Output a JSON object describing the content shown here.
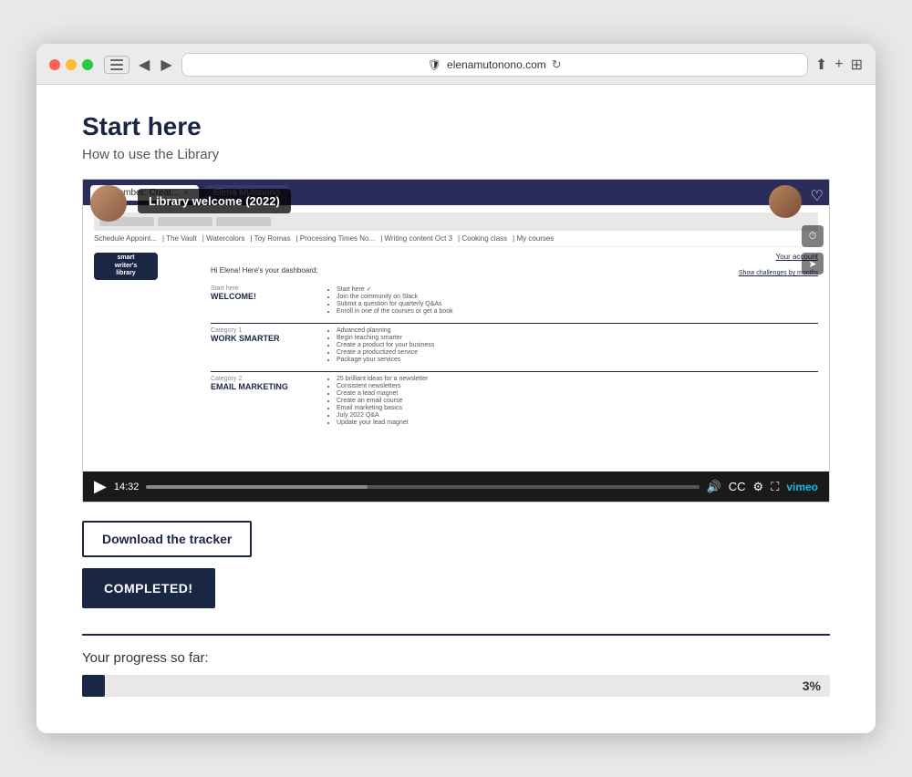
{
  "browser": {
    "url": "elenamutonono.com",
    "back_btn": "◀",
    "forward_btn": "▶",
    "refresh_icon": "↻",
    "share_icon": "⬆",
    "new_tab_icon": "+",
    "grid_icon": "⊞",
    "shield_icon": "🛡"
  },
  "page": {
    "title": "Start here",
    "subtitle": "How to use the Library"
  },
  "video": {
    "overlay_label": "Library welcome (2022)",
    "channel_name": "Elena Mutonono",
    "time_current": "14:32",
    "time_total": "14:32",
    "logo_line1": "smart",
    "logo_line2": "writer's",
    "logo_line3": "library"
  },
  "fake_website": {
    "tab1": "September: Creat...",
    "tab2": "Elena Mutonono",
    "account_link": "Your account",
    "dashboard_text": "Hi Elena! Here's your dashboard:",
    "show_challenges": "Show challenges by months",
    "section1": {
      "label": "Start here",
      "heading": "WELCOME!",
      "items": [
        "Start here ✓",
        "Join the community on Slack",
        "Submit a question for quarterly Q&As",
        "Enroll in one of the courses or get a book"
      ]
    },
    "section2": {
      "label": "Category 1",
      "heading": "WORK SMARTER",
      "items": [
        "Advanced planning",
        "Begin teaching smarter",
        "Create a product for your business",
        "Create a productized service",
        "Package your services"
      ]
    },
    "section3": {
      "label": "Category 2",
      "heading": "EMAIL MARKETING",
      "items": [
        "25 brilliant ideas for a newsletter",
        "Consistent newsletters",
        "Create a lead magnet",
        "Create an email course",
        "Email marketing basics",
        "July 2022 Q&A",
        "Update your lead magnet"
      ]
    }
  },
  "buttons": {
    "download": "Download the tracker",
    "completed": "COMPLETED!"
  },
  "progress": {
    "label": "Your progress so far:",
    "percentage": "3%",
    "value": 3
  }
}
